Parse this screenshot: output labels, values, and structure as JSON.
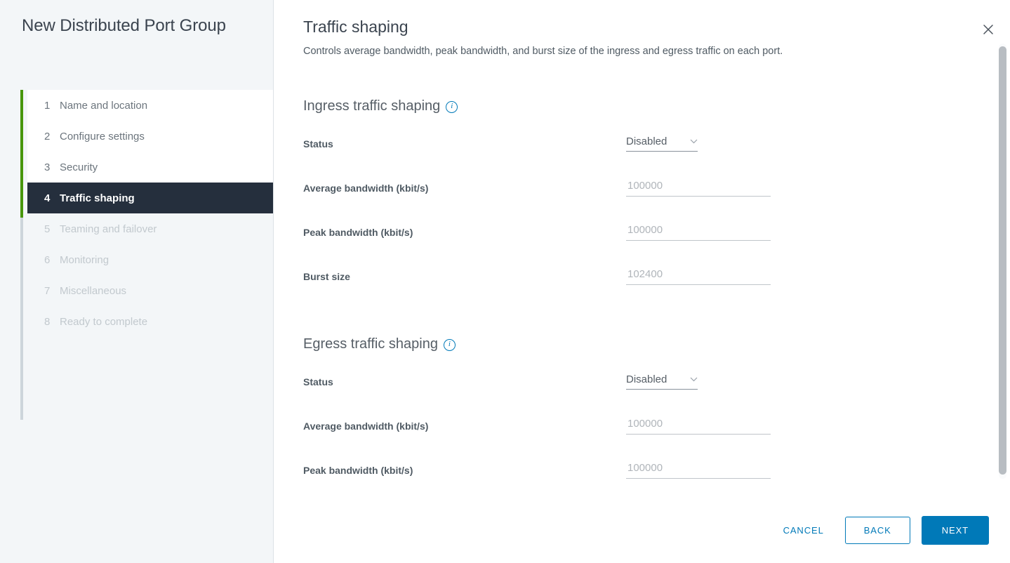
{
  "wizard": {
    "title": "New Distributed Port Group",
    "steps": [
      {
        "num": "1",
        "label": "Name and location",
        "state": "done"
      },
      {
        "num": "2",
        "label": "Configure settings",
        "state": "done"
      },
      {
        "num": "3",
        "label": "Security",
        "state": "done"
      },
      {
        "num": "4",
        "label": "Traffic shaping",
        "state": "active"
      },
      {
        "num": "5",
        "label": "Teaming and failover",
        "state": "future"
      },
      {
        "num": "6",
        "label": "Monitoring",
        "state": "future"
      },
      {
        "num": "7",
        "label": "Miscellaneous",
        "state": "future"
      },
      {
        "num": "8",
        "label": "Ready to complete",
        "state": "future"
      }
    ]
  },
  "panel": {
    "title": "Traffic shaping",
    "description": "Controls average bandwidth, peak bandwidth, and burst size of the ingress and egress traffic on each port.",
    "close_icon": "close-icon"
  },
  "ingress": {
    "heading": "Ingress traffic shaping",
    "info_icon": "info-icon",
    "status_label": "Status",
    "status_value": "Disabled",
    "avg_label": "Average bandwidth (kbit/s)",
    "avg_value": "100000",
    "peak_label": "Peak bandwidth (kbit/s)",
    "peak_value": "100000",
    "burst_label": "Burst size",
    "burst_value": "102400"
  },
  "egress": {
    "heading": "Egress traffic shaping",
    "info_icon": "info-icon",
    "status_label": "Status",
    "status_value": "Disabled",
    "avg_label": "Average bandwidth (kbit/s)",
    "avg_value": "100000",
    "peak_label": "Peak bandwidth (kbit/s)",
    "peak_value": "100000"
  },
  "footer": {
    "cancel_label": "CANCEL",
    "back_label": "BACK",
    "next_label": "NEXT"
  },
  "colors": {
    "accent_blue": "#0079b8",
    "progress_green": "#48960c",
    "active_step_bg": "#252f3d",
    "sidebar_bg": "#f3f6f8"
  }
}
